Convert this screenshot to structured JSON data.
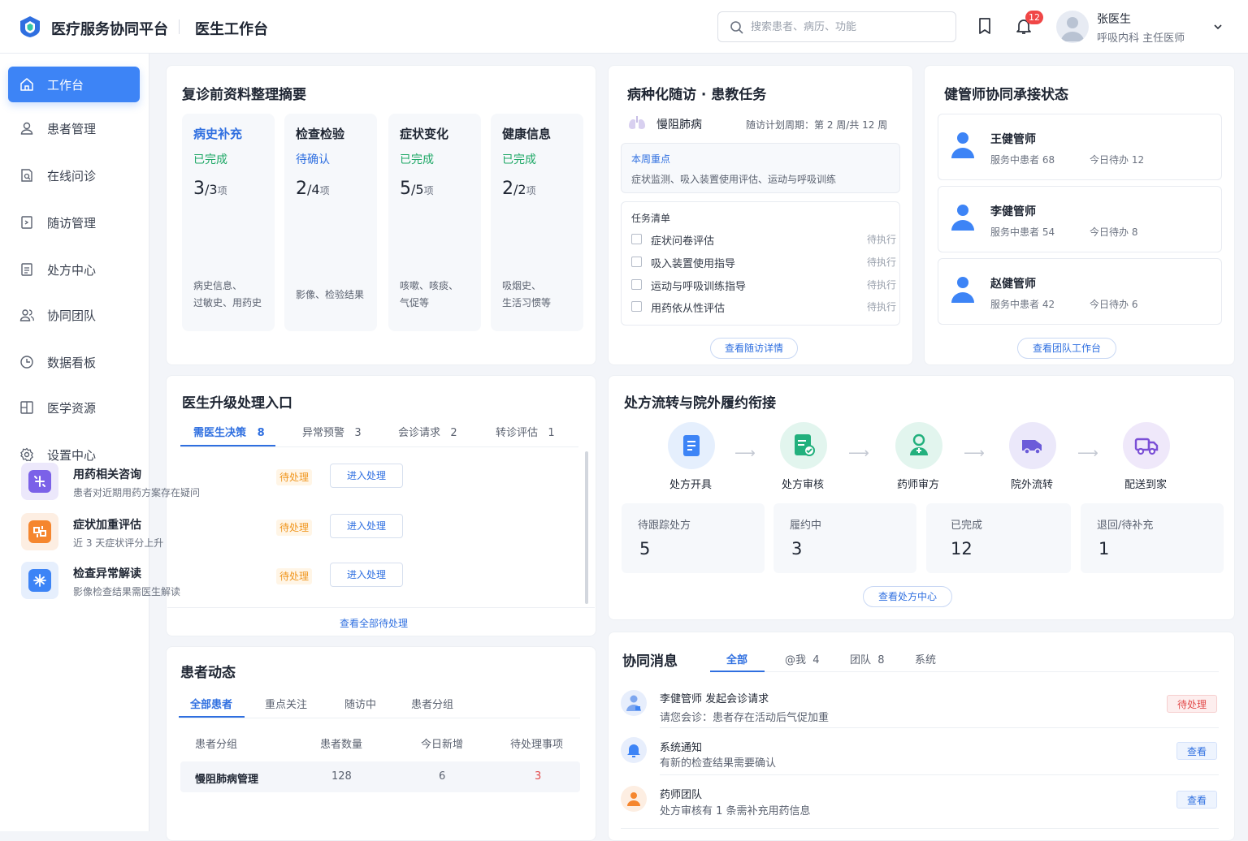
{
  "header": {
    "app_title": "医疗服务协同平台",
    "workspace_title": "医生工作台",
    "search_placeholder": "搜索患者、病历、功能",
    "notification_count": "12",
    "user_name": "张医生",
    "user_role": "呼吸内科  主任医师"
  },
  "sidebar": {
    "items": [
      {
        "label": "工作台",
        "icon": "home-icon",
        "active": true
      },
      {
        "label": "患者管理",
        "icon": "user-icon"
      },
      {
        "label": "在线问诊",
        "icon": "consult-icon"
      },
      {
        "label": "随访管理",
        "icon": "followup-icon"
      },
      {
        "label": "处方中心",
        "icon": "prescription-icon"
      },
      {
        "label": "协同团队",
        "icon": "team-icon"
      },
      {
        "label": "数据看板",
        "icon": "clock-chart-icon"
      },
      {
        "label": "医学资源",
        "icon": "grid-icon"
      },
      {
        "label": "设置中心",
        "icon": "gear-icon"
      }
    ]
  },
  "summary": {
    "title": "复诊前资料整理摘要",
    "cols": [
      {
        "title": "病史补充",
        "status": "已完成",
        "done": "3",
        "total": "/3",
        "unit": "项",
        "desc": "病史信息、\n过敏史、用药史"
      },
      {
        "title": "检查检验",
        "status": "待确认",
        "done": "2",
        "total": "/4",
        "unit": "项",
        "desc": "影像、检验结果"
      },
      {
        "title": "症状变化",
        "status": "已完成",
        "done": "5",
        "total": "/5",
        "unit": "项",
        "desc": "咳嗽、咳痰、\n气促等"
      },
      {
        "title": "健康信息",
        "status": "已完成",
        "done": "2",
        "total": "/2",
        "unit": "项",
        "desc": "吸烟史、\n生活习惯等"
      }
    ]
  },
  "followup": {
    "title": "病种化随访 · 患教任务",
    "disease": "慢阻肺病",
    "cycle": "随访计划周期：第 2 周/共 12 周",
    "focus_label": "本周重点",
    "focus_text": "症状监测、吸入装置使用评估、运动与呼吸训练",
    "task_label": "任务清单",
    "tasks": [
      {
        "name": "症状问卷评估",
        "status": "待执行"
      },
      {
        "name": "吸入装置使用指导",
        "status": "待执行"
      },
      {
        "name": "运动与呼吸训练指导",
        "status": "待执行"
      },
      {
        "name": "用药依从性评估",
        "status": "待执行"
      }
    ],
    "button": "查看随访详情"
  },
  "managers": {
    "title": "健管师协同承接状态",
    "items": [
      {
        "name": "王健管师",
        "patients": "服务中患者   68",
        "todo": "今日待办   12"
      },
      {
        "name": "李健管师",
        "patients": "服务中患者   54",
        "todo": "今日待办   8"
      },
      {
        "name": "赵健管师",
        "patients": "服务中患者   42",
        "todo": "今日待办   6"
      }
    ],
    "button": "查看团队工作台"
  },
  "escalation": {
    "title": "医生升级处理入口",
    "tabs": [
      {
        "label": "需医生决策",
        "count": "8"
      },
      {
        "label": "异常预警",
        "count": "3"
      },
      {
        "label": "会诊请求",
        "count": "2"
      },
      {
        "label": "转诊评估",
        "count": "1"
      }
    ],
    "items": [
      {
        "name": "用药相关咨询",
        "desc": "患者对近期用药方案存在疑问",
        "status": "待处理",
        "action": "进入处理",
        "color": "#7b61e8"
      },
      {
        "name": "症状加重评估",
        "desc": "近 3 天症状评分上升",
        "status": "待处理",
        "action": "进入处理",
        "color": "#f5862e"
      },
      {
        "name": "检查异常解读",
        "desc": "影像检查结果需医生解读",
        "status": "待处理",
        "action": "进入处理",
        "color": "#3d84f6"
      }
    ],
    "footer_link": "查看全部待处理"
  },
  "prescription": {
    "title": "处方流转与院外履约衔接",
    "steps": [
      {
        "label": "处方开具",
        "icon": "document-icon",
        "color": "#3d84f6"
      },
      {
        "label": "处方审核",
        "icon": "audit-icon",
        "color": "#22b07d"
      },
      {
        "label": "药师审方",
        "icon": "pharmacist-icon",
        "color": "#22b07d"
      },
      {
        "label": "院外流转",
        "icon": "van-icon",
        "color": "#6b5bd9"
      },
      {
        "label": "配送到家",
        "icon": "truck-icon",
        "color": "#7b4fd6"
      }
    ],
    "stats": [
      {
        "label": "待跟踪处方",
        "value": "5"
      },
      {
        "label": "履约中",
        "value": "3"
      },
      {
        "label": "已完成",
        "value": "12"
      },
      {
        "label": "退回/待补充",
        "value": "1"
      }
    ],
    "button": "查看处方中心"
  },
  "patients": {
    "title": "患者动态",
    "tabs": [
      "全部患者",
      "重点关注",
      "随访中",
      "患者分组"
    ],
    "columns": [
      "患者分组",
      "患者数量",
      "今日新增",
      "待处理事项"
    ],
    "rows": [
      {
        "group": "慢阻肺病管理",
        "count": "128",
        "new": "6",
        "pending": "3"
      }
    ]
  },
  "messages": {
    "title": "协同消息",
    "tabs": [
      {
        "label": "全部",
        "count": ""
      },
      {
        "label": "@我",
        "count": "4"
      },
      {
        "label": "团队",
        "count": "8"
      },
      {
        "label": "系统",
        "count": ""
      }
    ],
    "items": [
      {
        "title": "李健管师  发起会诊请求",
        "desc": "请您会诊：患者存在活动后气促加重",
        "action": "待处理"
      },
      {
        "title": "系统通知",
        "desc": "有新的检查结果需要确认",
        "action": "查看"
      },
      {
        "title": "药师团队",
        "desc": "处方审核有 1 条需补充用药信息",
        "action": "查看"
      }
    ]
  },
  "colors": {
    "accent": "#3d84f6",
    "success": "#1ea866",
    "warning": "#f0961e",
    "danger": "#e24a4a"
  }
}
